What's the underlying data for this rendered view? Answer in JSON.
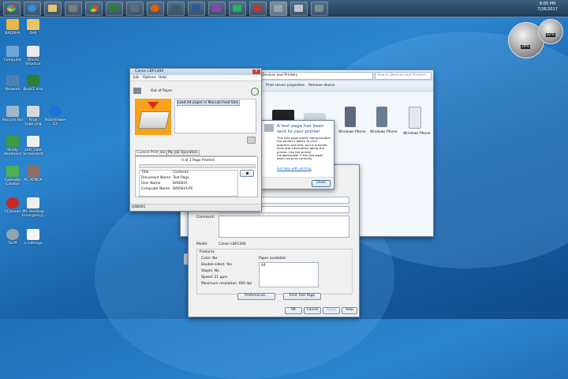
{
  "clock": {
    "time": "8:05 PM",
    "date": "7/26/2017"
  },
  "desktop_icons": [
    {
      "label": "BADSHA"
    },
    {
      "label": "Dell"
    },
    {
      "label": "Computer"
    },
    {
      "label": "Bhishi Shortcut"
    },
    {
      "label": "Network"
    },
    {
      "label": "Book1.xlsx"
    },
    {
      "label": "Recycle Bin"
    },
    {
      "label": "Final Logo.png"
    },
    {
      "label": "TeamViewer 12"
    },
    {
      "label": "Skinly Keyboard"
    },
    {
      "label": "Lets Take Screenshot"
    },
    {
      "label": "Calendar Creator"
    },
    {
      "label": "PC ATMCA"
    },
    {
      "label": "CCleaner"
    },
    {
      "label": "MS Desktop Emergency..."
    },
    {
      "label": "Tariff"
    },
    {
      "label": "a.indesign"
    }
  ],
  "gadget": {
    "cpu": "29%",
    "ram": "82%"
  },
  "explorer": {
    "breadcrumb": "Devices and Printers",
    "search_placeholder": "Search Devices and Printers",
    "toolbar": [
      "Print server properties",
      "Remove device"
    ],
    "devices": [
      "Windows Phone",
      "Windows Phone",
      "Windows Phone"
    ]
  },
  "test_page_dialog": {
    "heading": "A test page has been sent to your printer",
    "body": "This test page briefly demonstrates the printer's ability to print graphics and text, and it provides technical information about the printer. Use the printer troubleshooter if the test page does not print correctly.",
    "link": "Get help with printing",
    "close_label": "Close"
  },
  "properties": {
    "comment_label": "Comment:",
    "model_label": "Model:",
    "model_value": "Canon LBP1300",
    "features_label": "Features",
    "color": "Color: No",
    "double_sided": "Double-sided: Yes",
    "staple": "Staple: No",
    "speed": "Speed: 21 ppm",
    "resolution": "Maximum resolution: 600 dpi",
    "paper_label": "Paper available:",
    "paper_value": "A4",
    "preferences_label": "Preferences...",
    "print_test_label": "Print Test Page",
    "ok_label": "OK",
    "cancel_label": "Cancel",
    "apply_label": "Apply",
    "help_label": "Help"
  },
  "status_window": {
    "title": "Canon LBP1300",
    "menu": [
      "Job",
      "Options",
      "Help"
    ],
    "status": "Out of Paper",
    "message": "Load A4 paper in Manual Feed Slot.",
    "tabs": [
      "Current Print Job",
      "My Job Operation"
    ],
    "pages_printed": "0 of 1 Page Printed",
    "table_headers": [
      "Title",
      "Contents"
    ],
    "rows": [
      {
        "title": "Document Name",
        "value": "Test Page"
      },
      {
        "title": "User Name",
        "value": "BADSHA"
      },
      {
        "title": "Computer Name",
        "value": "BADSHA-PC"
      }
    ],
    "status_bar": "USB001"
  },
  "colors": {
    "accent": "#1f6fc0",
    "dialog_heading": "#1e4f96",
    "warning": "#e0261b",
    "status_highlight": "#cfe0f6"
  }
}
